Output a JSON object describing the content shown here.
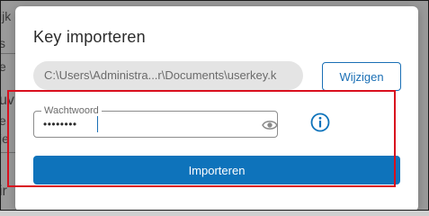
{
  "dialog": {
    "title": "Key importeren",
    "file_path": "C:\\Users\\Administra...r\\Documents\\userkey.k",
    "change_label": "Wijzigen",
    "password": {
      "label": "Wachtwoord",
      "masked_value": "••••••••"
    },
    "import_label": "Importeren"
  },
  "background": {
    "fragments": [
      "ijk",
      "s",
      "e",
      "uv",
      "e",
      "je",
      "ir"
    ]
  },
  "colors": {
    "accent": "#0e73bb",
    "highlight_border": "#d9101e",
    "overlay": "#9a9a9a"
  },
  "icons": {
    "password_toggle": "eye-icon",
    "info": "info-icon"
  }
}
